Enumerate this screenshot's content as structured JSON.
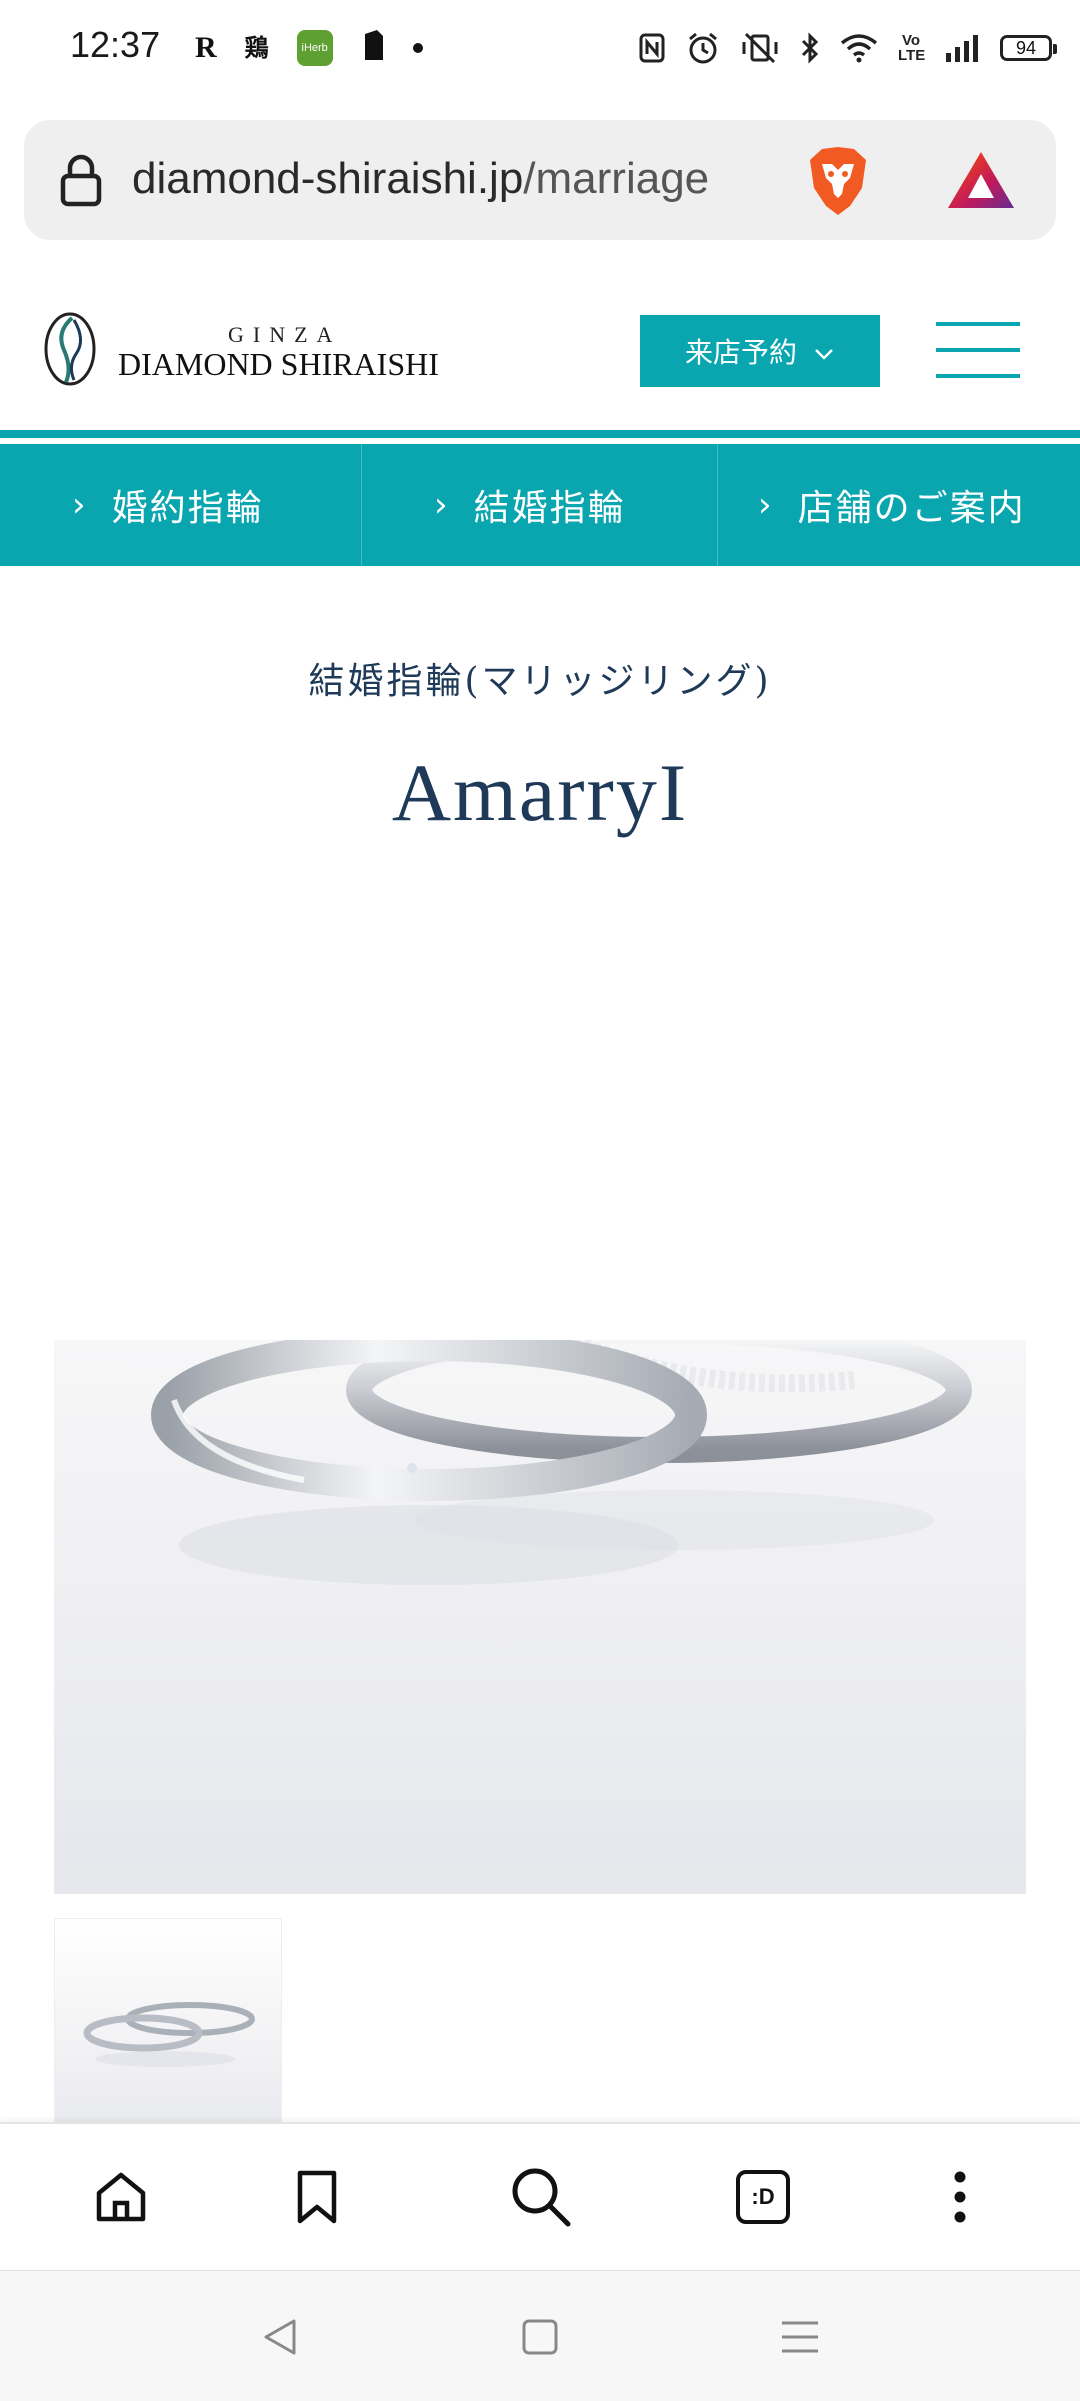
{
  "status_bar": {
    "time": "12:37",
    "left_icons": [
      "rakuten-icon",
      "app-kanji-icon",
      "iherb-icon",
      "app-icon",
      "notification-dot-icon"
    ],
    "rakuten_glyph": "R",
    "kanji_glyph": "鶏",
    "iherb_label": "iHerb",
    "right_icons": [
      "nfc-icon",
      "alarm-icon",
      "vibrate-off-icon",
      "bluetooth-icon",
      "wifi-icon",
      "volte-icon",
      "signal-icon",
      "battery-icon"
    ],
    "volte_label": "Vo LTE",
    "battery_level": "94"
  },
  "browser": {
    "url_domain": "diamond-shiraishi.jp",
    "url_path": "/marriage",
    "toolbar_icons": [
      "home-icon",
      "bookmark-icon",
      "search-icon",
      "tabs-icon",
      "more-menu-icon"
    ],
    "tabs_label": ":D"
  },
  "site": {
    "logo_top": "GINZA",
    "logo_name": "DIAMOND SHIRAISHI",
    "reserve_label": "来店予約",
    "brand_color": "#0aa6b0",
    "nav": [
      {
        "label": "婚約指輪"
      },
      {
        "label": "結婚指輪"
      },
      {
        "label": "店舗のご案内"
      }
    ]
  },
  "product": {
    "category": "結婚指輪(マリッジリング)",
    "title": "AmarryI"
  },
  "system_nav": [
    "back-icon",
    "home-square-icon",
    "recents-icon"
  ]
}
